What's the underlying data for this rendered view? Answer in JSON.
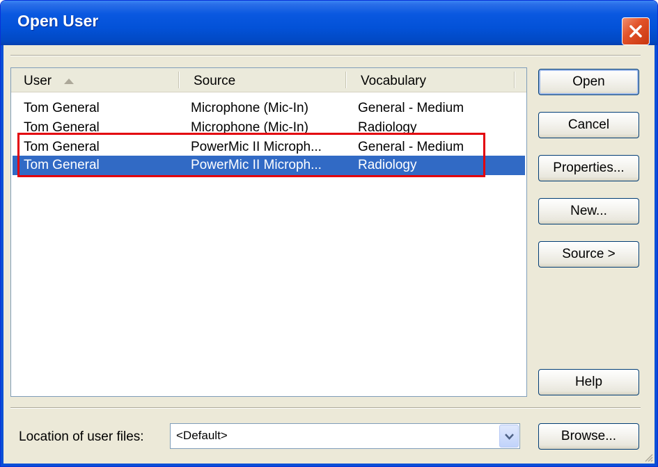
{
  "window": {
    "title": "Open User"
  },
  "list": {
    "columns": [
      "User",
      "Source",
      "Vocabulary"
    ],
    "rows": [
      {
        "user": "Tom General",
        "source": "Microphone (Mic-In)",
        "vocabulary": "General - Medium",
        "selected": false
      },
      {
        "user": "Tom General",
        "source": "Microphone (Mic-In)",
        "vocabulary": "Radiology",
        "selected": false
      },
      {
        "user": "Tom General",
        "source": "PowerMic II Microph...",
        "vocabulary": "General - Medium",
        "selected": false
      },
      {
        "user": "Tom General",
        "source": "PowerMic II Microph...",
        "vocabulary": "Radiology",
        "selected": true
      }
    ]
  },
  "buttons": {
    "open": "Open",
    "cancel": "Cancel",
    "properties": "Properties...",
    "new": "New...",
    "source": "Source >",
    "help": "Help",
    "browse": "Browse..."
  },
  "location": {
    "label": "Location of user files:",
    "value": "<Default>"
  },
  "colors": {
    "title_bar": "#0352d8",
    "selection": "#316ac5",
    "highlight_box": "#e3000b",
    "dialog_bg": "#ece9d8"
  }
}
